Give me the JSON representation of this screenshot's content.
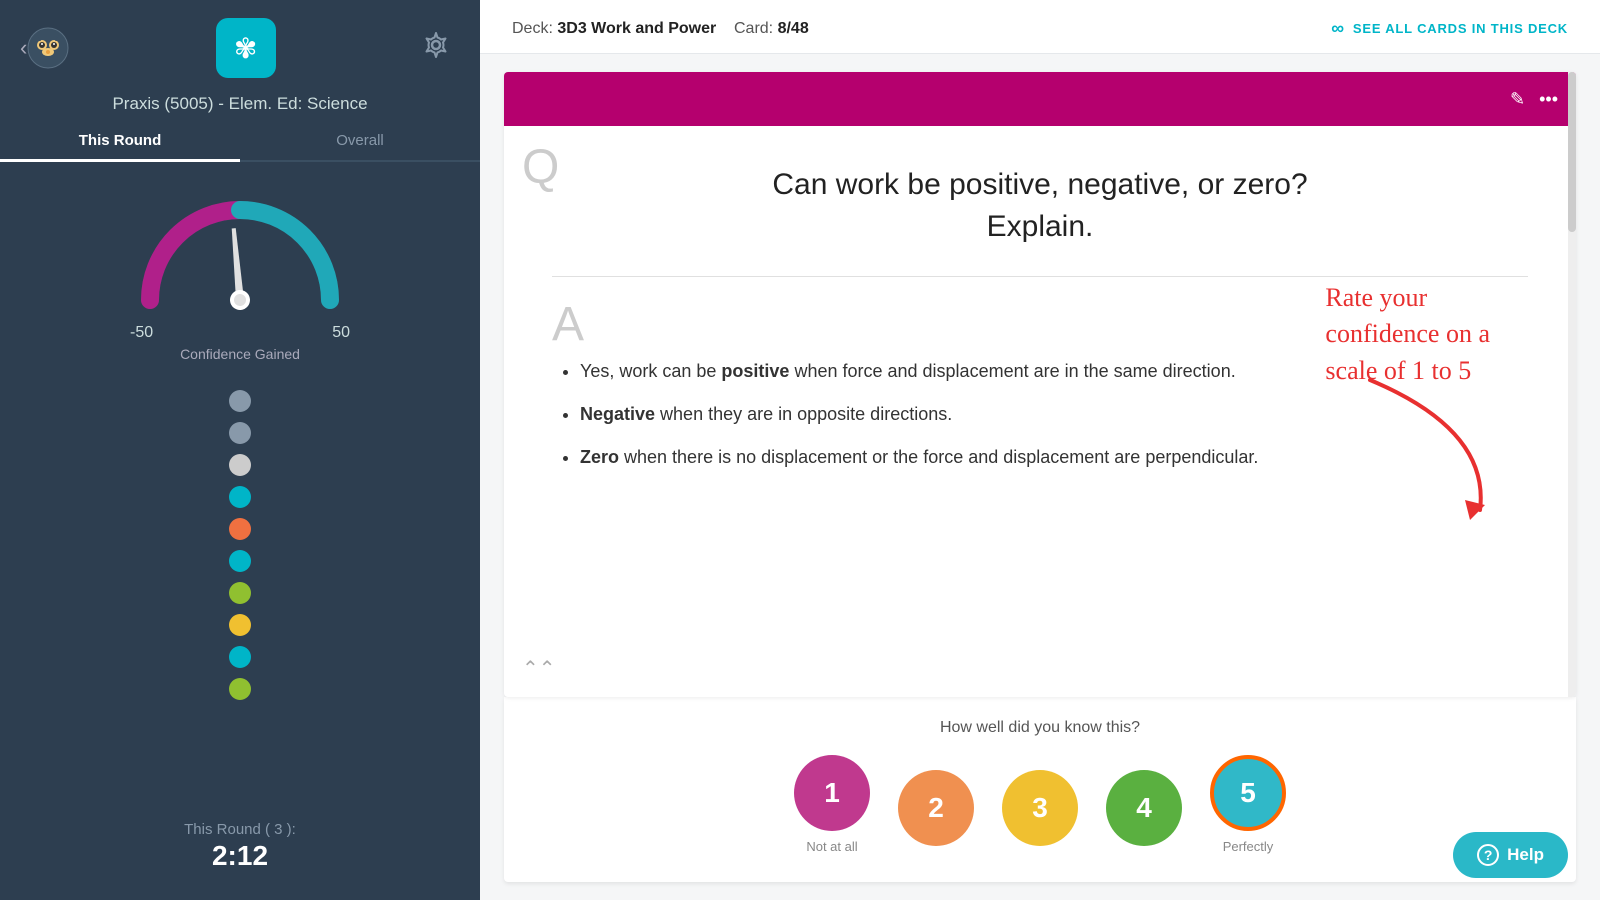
{
  "sidebar": {
    "back_icon": "‹",
    "logo_icon": "✿",
    "gear_icon": "⚙",
    "deck_title": "Praxis (5005) - Elem. Ed: Science",
    "tabs": [
      {
        "label": "This Round",
        "active": true
      },
      {
        "label": "Overall",
        "active": false
      }
    ],
    "gauge": {
      "label_left": "-50",
      "label_right": "50",
      "title": "Confidence Gained"
    },
    "dots": [
      {
        "color": "#8899aa"
      },
      {
        "color": "#8899aa"
      },
      {
        "color": "#cccccc"
      },
      {
        "color": "#00b5c8"
      },
      {
        "color": "#f07040"
      },
      {
        "color": "#00b5c8"
      },
      {
        "color": "#90c030"
      },
      {
        "color": "#f0c030"
      },
      {
        "color": "#00b5c8"
      },
      {
        "color": "#90c030"
      }
    ],
    "round_label": "This Round ( 3 ):",
    "round_time": "2:12"
  },
  "topbar": {
    "deck_prefix": "Deck:",
    "deck_name": "3D3 Work and Power",
    "card_prefix": "Card:",
    "card_value": "8/48",
    "see_all_text": "SEE ALL CARDS IN THIS DECK"
  },
  "card": {
    "question": "Can work be positive, negative, or zero?\nExplain.",
    "answer_bullets": [
      "Yes, work can be <b>positive</b> when force and displacement are in the same direction.",
      "<b>Negative</b> when they are in opposite directions.",
      "<b>Zero</b> when there is no displacement or the force and displacement are perpendicular."
    ]
  },
  "rating": {
    "question": "How well did you know this?",
    "buttons": [
      {
        "value": "1",
        "label": "Not at all",
        "class": "btn-1"
      },
      {
        "value": "2",
        "label": "",
        "class": "btn-2"
      },
      {
        "value": "3",
        "label": "",
        "class": "btn-3"
      },
      {
        "value": "4",
        "label": "",
        "class": "btn-4"
      },
      {
        "value": "5",
        "label": "Perfectly",
        "class": "btn-5"
      }
    ],
    "help_label": "Help"
  },
  "annotation": {
    "text": "Rate your\nconfidence on a\nscale of 1 to 5"
  }
}
